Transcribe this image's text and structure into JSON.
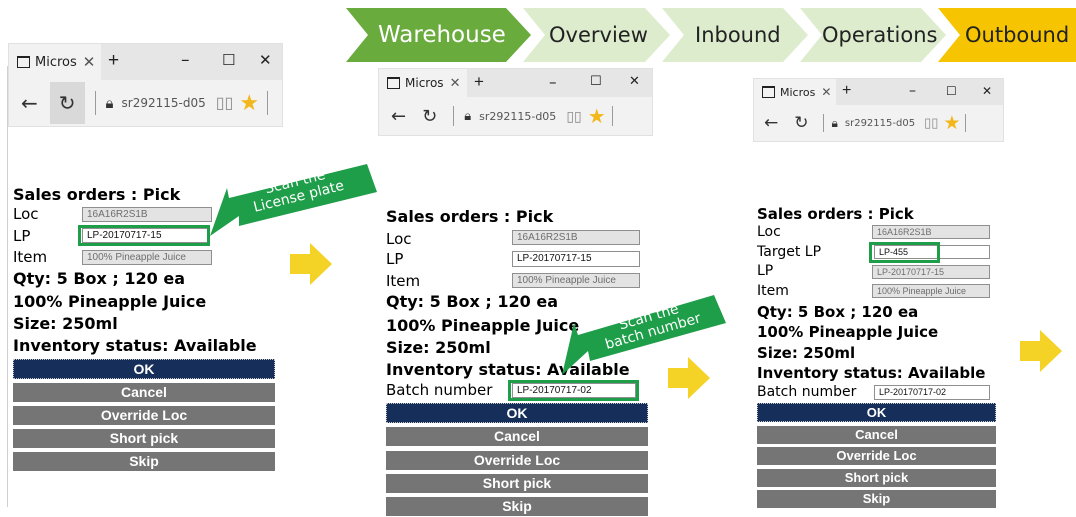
{
  "process": {
    "steps": [
      {
        "label": "Warehouse",
        "active": true
      },
      {
        "label": "Overview"
      },
      {
        "label": "Inbound"
      },
      {
        "label": "Operations"
      },
      {
        "label": "Outbound",
        "highlight": true
      }
    ]
  },
  "browser": {
    "tab_title": "Micros",
    "url": "sr292115-d05"
  },
  "form1": {
    "title": "Sales orders : Pick",
    "loc_label": "Loc",
    "loc_value": "16A16R2S1B",
    "lp_label": "LP",
    "lp_value": "LP-20170717-15",
    "item_label": "Item",
    "item_value": "100% Pineapple Juice",
    "qty": "Qty: 5 Box ; 120 ea",
    "product": "100% Pineapple Juice",
    "size": "Size: 250ml",
    "status": "Inventory status: Available",
    "buttons": [
      "OK",
      "Cancel",
      "Override Loc",
      "Short pick",
      "Skip"
    ]
  },
  "form2": {
    "title": "Sales orders : Pick",
    "loc_label": "Loc",
    "loc_value": "16A16R2S1B",
    "lp_label": "LP",
    "lp_value": "LP-20170717-15",
    "item_label": "Item",
    "item_value": "100% Pineapple Juice",
    "qty": "Qty: 5 Box ; 120 ea",
    "product": "100% Pineapple Juice",
    "size": "Size: 250ml",
    "status": "Inventory status: Available",
    "batch_label": "Batch number",
    "batch_value": "LP-20170717-02",
    "buttons": [
      "OK",
      "Cancel",
      "Override Loc",
      "Short pick",
      "Skip"
    ]
  },
  "form3": {
    "title": "Sales orders : Pick",
    "loc_label": "Loc",
    "loc_value": "16A16R2S1B",
    "target_lp_label": "Target LP",
    "target_lp_value": "LP-455",
    "lp_label": "LP",
    "lp_value": "LP-20170717-15",
    "item_label": "Item",
    "item_value": "100% Pineapple Juice",
    "qty": "Qty: 5 Box ; 120 ea",
    "product": "100% Pineapple Juice",
    "size": "Size: 250ml",
    "status": "Inventory status: Available",
    "batch_label": "Batch number",
    "batch_value": "LP-20170717-02",
    "buttons": [
      "OK",
      "Cancel",
      "Override Loc",
      "Short pick",
      "Skip"
    ]
  },
  "callouts": {
    "scan_lp_line1": "Scan the",
    "scan_lp_line2": "License plate",
    "scan_batch_line1": "Scan the",
    "scan_batch_line2": "batch number"
  },
  "colors": {
    "green": "#6aab3e",
    "light_green": "#dceccd",
    "yellow": "#f6c400",
    "navy": "#162f5a",
    "button_gray": "#757575",
    "highlight_green": "#1f9e4a",
    "arrow_yellow": "#f5d226"
  },
  "icons": [
    "tab-icon",
    "close-icon",
    "plus-icon",
    "minimize-icon",
    "maximize-icon",
    "back-icon",
    "reload-icon",
    "lock-icon",
    "reading-view-icon",
    "favorite-star-icon"
  ]
}
